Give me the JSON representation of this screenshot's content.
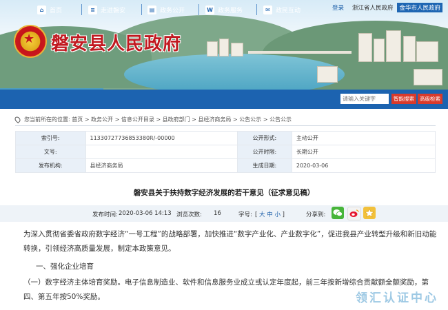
{
  "header": {
    "site_title": "磐安县人民政府",
    "login": "登录",
    "gov_link_1": "浙江省人民政府",
    "gov_link_2": "金华市人民政府"
  },
  "nav": {
    "items": [
      {
        "label": "首页",
        "icon": "home-icon"
      },
      {
        "label": "走进磐安",
        "icon": "document-icon"
      },
      {
        "label": "政务公开",
        "icon": "book-icon"
      },
      {
        "label": "政务服务",
        "icon": "w-icon"
      },
      {
        "label": "政民互动",
        "icon": "chat-icon"
      }
    ],
    "search_placeholder": "请输入关键字",
    "search_button": "智能搜索",
    "advanced_button": "高级检索"
  },
  "breadcrumb": {
    "text": "您当前所在的位置: 首页 > 政务公开 > 信息公开目录 > 县政府部门 > 县经济商务局 > 公告公示 > 公告公示"
  },
  "info": {
    "index_label": "索引号:",
    "index_value": "11330727736853380R/-00000",
    "form_label": "公开形式:",
    "form_value": "主动公开",
    "docno_label": "文号:",
    "docno_value": "",
    "period_label": "公开时限:",
    "period_value": "长期公开",
    "org_label": "发布机构:",
    "org_value": "县经济商务局",
    "date_label": "生成日期:",
    "date_value": "2020-03-06"
  },
  "article": {
    "title": "磐安县关于扶持数字经济发展的若干意见（征求意见稿）",
    "publish_label": "发布时间:",
    "publish_time": "2020-03-06 14:13",
    "views_label": "浏览次数:",
    "views": "16",
    "font_label": "字号:",
    "font_large": "大",
    "font_medium": "中",
    "font_small": "小",
    "share_label": "分享到:",
    "p1": "为深入贯彻省委省政府数字经济“一号工程”的战略部署，加快推进“数字产业化、产业数字化”，促进我县产业转型升级和新旧动能转换，引领经济高质量发展，制定本政策意见。",
    "p2": "一、强化企业培育",
    "p3": "（一）数字经济主体培育奖励。电子信息制造业、软件和信息服务业成立或认定年度起，前三年按新增综合贡献额全额奖励，第四、第五年按50%奖励。"
  },
  "watermark": "领汇认证中心",
  "colors": {
    "nav": "#1c63b0",
    "title_red": "#c11920",
    "search_red": "#d93a2b"
  }
}
